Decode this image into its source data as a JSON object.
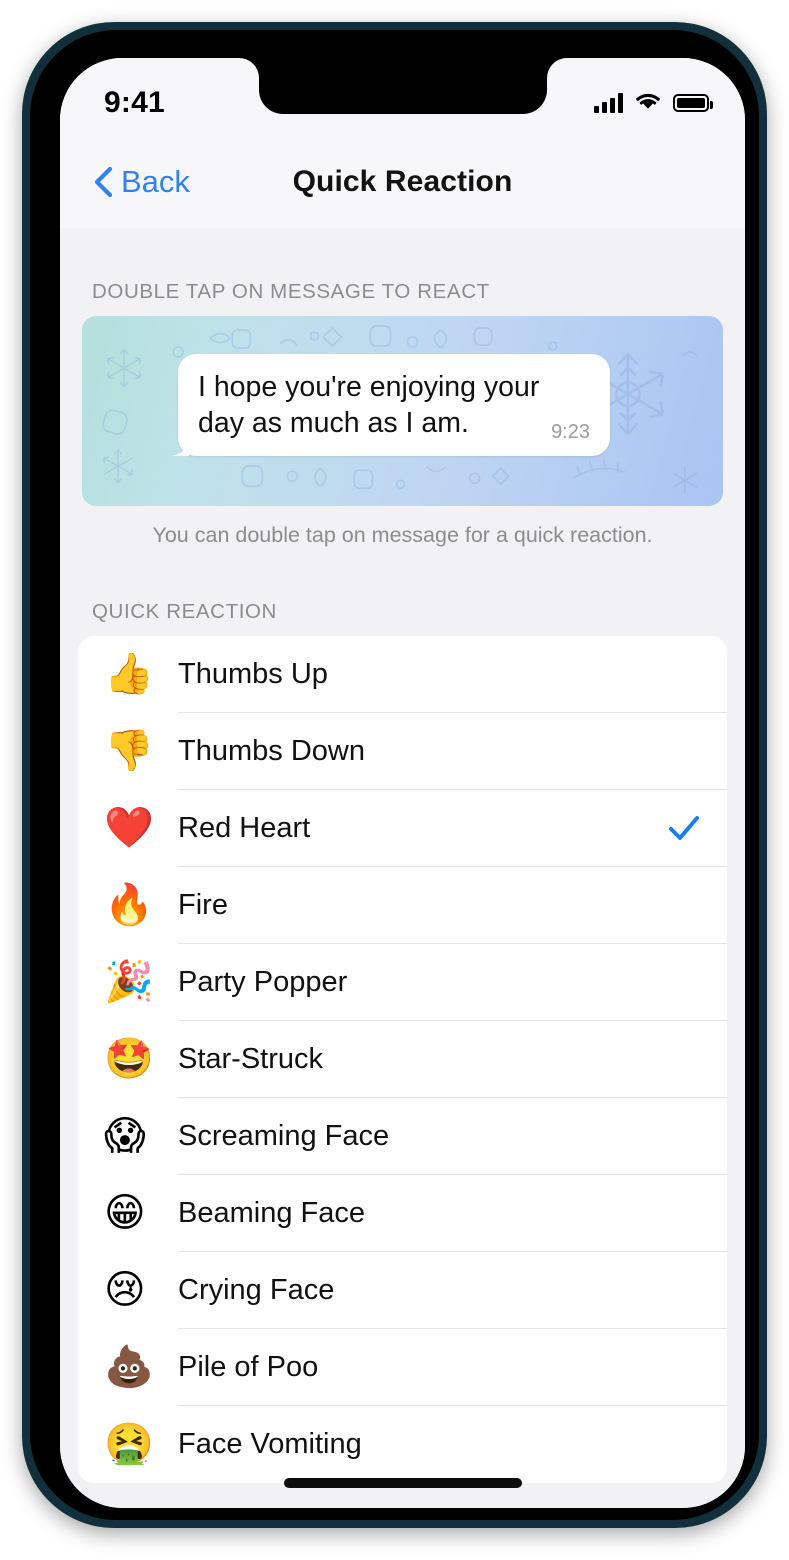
{
  "status_bar": {
    "time": "9:41",
    "signal_icon": "cellular-signal-icon",
    "wifi_icon": "wifi-icon",
    "battery_icon": "battery-full-icon"
  },
  "nav": {
    "back_label": "Back",
    "back_icon": "chevron-left-icon",
    "title": "Quick Reaction"
  },
  "message_section": {
    "header": "DOUBLE TAP ON MESSAGE TO REACT",
    "bubble_text": "I hope you're enjoying your day as much as I am.",
    "bubble_time": "9:23",
    "footer_note": "You can double tap on message for a quick reaction."
  },
  "quick_reaction_section": {
    "header": "QUICK REACTION",
    "selected": "Red Heart",
    "check_icon": "checkmark-icon",
    "items": [
      {
        "emoji": "👍",
        "label": "Thumbs Up",
        "selected": false
      },
      {
        "emoji": "👎",
        "label": "Thumbs Down",
        "selected": false
      },
      {
        "emoji": "❤️",
        "label": "Red Heart",
        "selected": true
      },
      {
        "emoji": "🔥",
        "label": "Fire",
        "selected": false
      },
      {
        "emoji": "🎉",
        "label": "Party Popper",
        "selected": false
      },
      {
        "emoji": "🤩",
        "label": "Star-Struck",
        "selected": false
      },
      {
        "emoji": "😱",
        "label": "Screaming Face",
        "selected": false
      },
      {
        "emoji": "😁",
        "label": "Beaming Face",
        "selected": false
      },
      {
        "emoji": "😢",
        "label": "Crying Face",
        "selected": false
      },
      {
        "emoji": "💩",
        "label": "Pile of Poo",
        "selected": false
      },
      {
        "emoji": "🤮",
        "label": "Face Vomiting",
        "selected": false
      }
    ]
  },
  "colors": {
    "accent_blue": "#2f82f0",
    "check_blue": "#1a7ef0",
    "screen_bg": "#f2f2f5",
    "bar_bg": "#f7f7f9",
    "bubble_gradient_start": "#b4e0dc",
    "bubble_gradient_end": "#a9c4f2",
    "frame_outer": "#12303c",
    "separator": "#e4e4e8",
    "muted_text": "#8b8b91"
  },
  "home_indicator": "home-indicator"
}
